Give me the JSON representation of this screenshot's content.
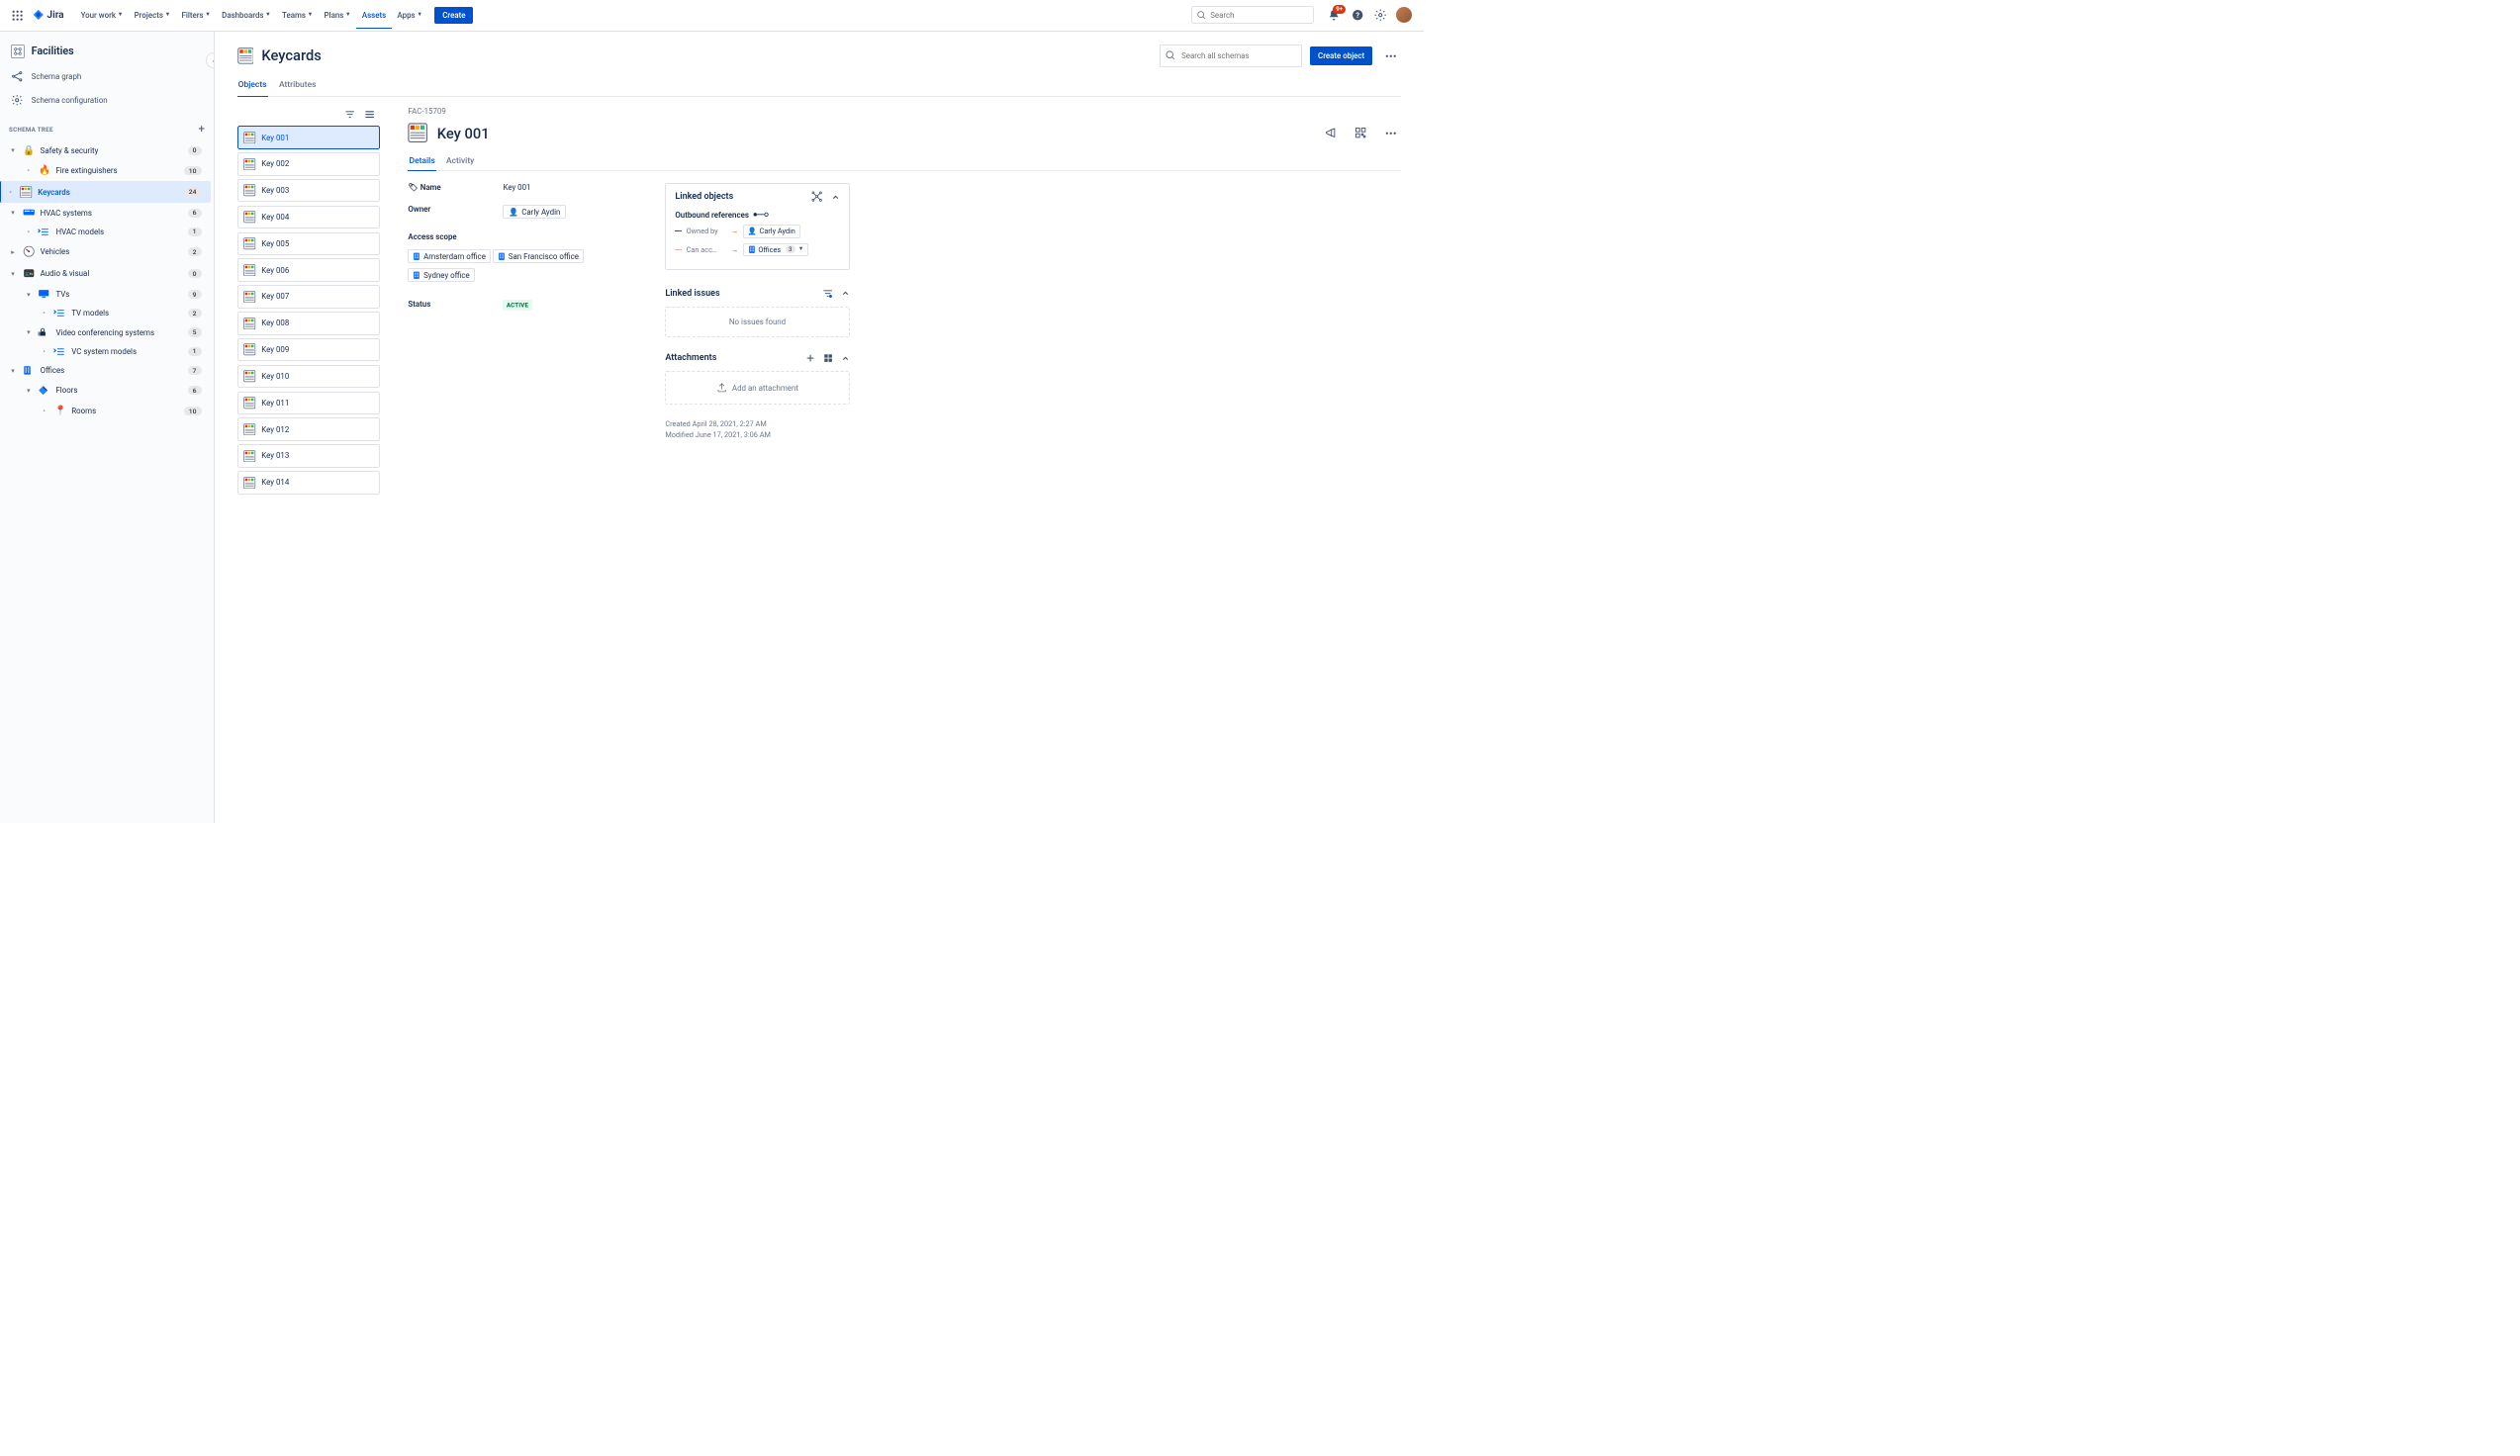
{
  "nav": {
    "product": "Jira",
    "items": [
      "Your work",
      "Projects",
      "Filters",
      "Dashboards",
      "Teams",
      "Plans",
      "Assets",
      "Apps"
    ],
    "active": "Assets",
    "create": "Create",
    "search_placeholder": "Search",
    "notif_badge": "9+"
  },
  "sidebar": {
    "title": "Facilities",
    "links": [
      {
        "label": "Schema graph"
      },
      {
        "label": "Schema configuration"
      }
    ],
    "section": "SCHEMA TREE",
    "tree": [
      {
        "type": "expand",
        "icon": "🔒",
        "iconColor": "#FF991F",
        "label": "Safety & security",
        "count": "0",
        "indent": 0
      },
      {
        "type": "leaf",
        "icon": "🔥",
        "label": "Fire extinguishers",
        "count": "10",
        "indent": 1
      },
      {
        "type": "leaf",
        "icon": "keycard",
        "label": "Keycards",
        "count": "24",
        "indent": 1,
        "selected": true
      },
      {
        "type": "expand",
        "icon": "hvac",
        "label": "HVAC systems",
        "count": "6",
        "indent": 0
      },
      {
        "type": "leaf",
        "icon": "list",
        "label": "HVAC models",
        "count": "1",
        "indent": 1
      },
      {
        "type": "expand",
        "icon": "gauge",
        "label": "Vehicles",
        "count": "2",
        "indent": 0,
        "chev": "right"
      },
      {
        "type": "expand",
        "icon": "atv",
        "label": "Audio & visual",
        "count": "0",
        "indent": 0
      },
      {
        "type": "expand",
        "icon": "tv",
        "label": "TVs",
        "count": "9",
        "indent": 1
      },
      {
        "type": "leaf",
        "icon": "list",
        "label": "TV models",
        "count": "2",
        "indent": 2
      },
      {
        "type": "expand",
        "icon": "cam",
        "label": "Video conferencing systems",
        "count": "5",
        "indent": 1
      },
      {
        "type": "leaf",
        "icon": "list",
        "label": "VC system models",
        "count": "1",
        "indent": 2
      },
      {
        "type": "expand",
        "icon": "office",
        "label": "Offices",
        "count": "7",
        "indent": 0
      },
      {
        "type": "expand",
        "icon": "floor",
        "label": "Floors",
        "count": "6",
        "indent": 1
      },
      {
        "type": "leaf",
        "icon": "📍",
        "label": "Rooms",
        "count": "10",
        "indent": 2
      }
    ]
  },
  "page": {
    "title": "Keycards",
    "search_placeholder": "Search all schemas",
    "create_object": "Create object",
    "tabs": [
      "Objects",
      "Attributes"
    ],
    "active_tab": "Objects"
  },
  "object_list": [
    "Key 001",
    "Key 002",
    "Key 003",
    "Key 004",
    "Key 005",
    "Key 006",
    "Key 007",
    "Key 008",
    "Key 009",
    "Key 010",
    "Key 011",
    "Key 012",
    "Key 013",
    "Key 014"
  ],
  "selected_object": "Key 001",
  "detail": {
    "key": "FAC-15709",
    "title": "Key 001",
    "tabs": [
      "Details",
      "Activity"
    ],
    "active_tab": "Details",
    "fields": {
      "name_label": "Name",
      "name_value": "Key 001",
      "owner_label": "Owner",
      "owner_value": "Carly Aydin",
      "access_label": "Access scope",
      "offices": [
        "Amsterdam office",
        "San Francisco office",
        "Sydney office"
      ],
      "status_label": "Status",
      "status_value": "ACTIVE"
    }
  },
  "linked_objects": {
    "title": "Linked objects",
    "outbound": "Outbound references",
    "refs": [
      {
        "bar": "#5E4B3C",
        "label": "Owned by",
        "target": "Carly Aydin",
        "type": "person"
      },
      {
        "bar": "#E2B3B3",
        "label": "Can acc…",
        "target": "Offices",
        "count": "3",
        "type": "office"
      }
    ]
  },
  "linked_issues": {
    "title": "Linked issues",
    "empty": "No issues found"
  },
  "attachments": {
    "title": "Attachments",
    "empty": "Add an attachment"
  },
  "meta": {
    "created": "Created April 28, 2021, 2:27 AM",
    "modified": "Modified June 17, 2021, 3:06 AM"
  }
}
